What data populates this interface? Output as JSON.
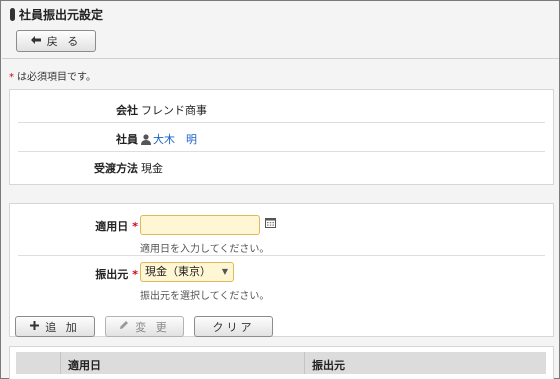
{
  "header": {
    "title": "社員振出元設定",
    "back_label": "戻 る"
  },
  "required_note": "は必須項目です。",
  "required_star": "*",
  "info": {
    "company_label": "会社",
    "company_value": "フレンド商事",
    "employee_label": "社員",
    "employee_value": "大木　明",
    "method_label": "受渡方法",
    "method_value": "現金"
  },
  "form": {
    "date_label": "適用日",
    "date_value": "",
    "date_hint": "適用日を入力してください。",
    "source_label": "振出元",
    "source_value": "現金（東京）",
    "source_hint": "振出元を選択してください。"
  },
  "actions": {
    "add_label": "追 加",
    "change_label": "変 更",
    "clear_label": "クリア"
  },
  "table": {
    "columns": [
      "適用日",
      "振出元"
    ]
  },
  "icons": {
    "back": "arrow-left-icon",
    "add": "plus-icon",
    "change": "pencil-icon",
    "calendar": "calendar-icon",
    "person": "person-icon"
  },
  "colors": {
    "required": "#d0021b",
    "link": "#1a62c9",
    "input_bg": "#fff6d4",
    "input_border": "#e0b860"
  }
}
